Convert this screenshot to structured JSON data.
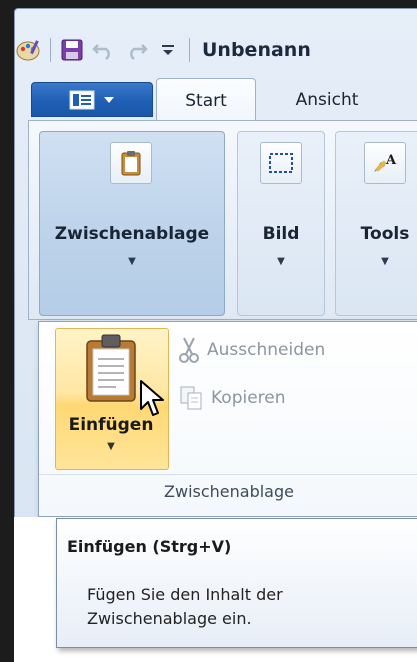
{
  "window": {
    "title": "Unbenann"
  },
  "ribbon": {
    "tabs": [
      {
        "label": "Start",
        "active": true
      },
      {
        "label": "Ansicht",
        "active": false
      }
    ],
    "groups": [
      {
        "label": "Zwischenablage",
        "icon": "clipboard-icon",
        "expanded": true
      },
      {
        "label": "Bild",
        "icon": "selection-icon"
      },
      {
        "label": "Tools",
        "icon": "tools-icon"
      }
    ]
  },
  "panel": {
    "paste_label": "Einfügen",
    "cut_label": "Ausschneiden",
    "copy_label": "Kopieren",
    "group_label": "Zwischenablage"
  },
  "tooltip": {
    "title": "Einfügen (Strg+V)",
    "body": "Fügen Sie den Inhalt der Zwischenablage ein."
  },
  "colors": {
    "accent": "#1f5fb4",
    "highlight": "#ffd874"
  }
}
